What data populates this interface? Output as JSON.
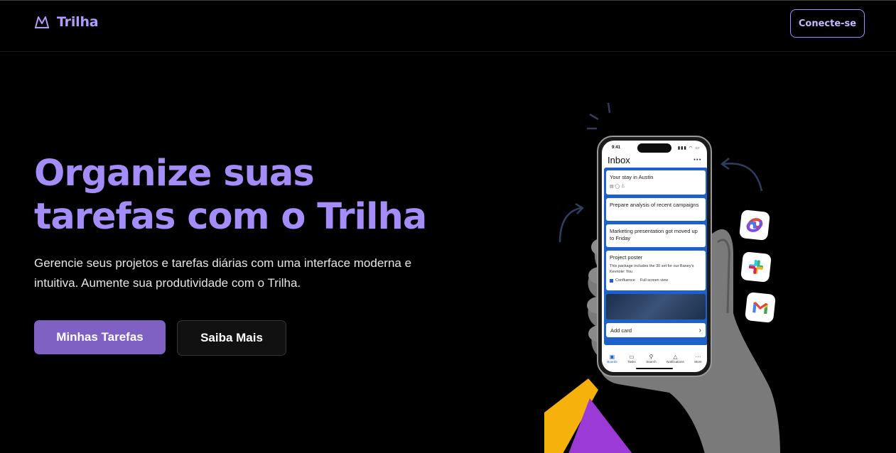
{
  "header": {
    "brand_name": "Trilha",
    "brand_icon": "mountain-logo-icon",
    "connect_label": "Conecte-se"
  },
  "hero": {
    "title_line1": "Organize suas",
    "title_line2": "tarefas com o Trilha",
    "subtitle_line1": "Gerencie seus projetos e tarefas diárias com uma interface moderna e",
    "subtitle_line2": "intuitiva. Aumente sua produtividade com o Trilha.",
    "primary_button": "Minhas Tarefas",
    "secondary_button": "Saiba Mais"
  },
  "phone": {
    "time": "9:41",
    "status_icons": "▮▮▮ ◠ ▭",
    "screen_title": "Inbox",
    "more": "···",
    "cards": [
      {
        "title": "Your stay in Austin",
        "meta": "▤ ◯ ⏃"
      },
      {
        "title": "Prepare analysis of recent campaigns"
      },
      {
        "title": "Marketing presentation got moved up to Friday"
      },
      {
        "title": "Project poster",
        "detail": "This package includes the 30 set for our Baney's Kevnole: You",
        "confluence": "Confluence",
        "full_screen": "Full screen view"
      }
    ],
    "add_card": "Add card",
    "add_card_chevron": "›",
    "tabs": [
      {
        "label": "Boards",
        "icon": "boards-icon",
        "glyph": "▣"
      },
      {
        "label": "Tasks",
        "icon": "tasks-icon",
        "glyph": "▭"
      },
      {
        "label": "Search",
        "icon": "search-icon",
        "glyph": "⚲"
      },
      {
        "label": "Notifications",
        "icon": "bell-icon",
        "glyph": "△"
      },
      {
        "label": "More",
        "icon": "more-icon",
        "glyph": "···"
      }
    ]
  },
  "integrations": [
    "copilot-icon",
    "slack-icon",
    "gmail-icon"
  ],
  "colors": {
    "accent": "#a48cf9",
    "primary_button": "#7e61c2",
    "board_blue": "#1d62c9",
    "yellow_shape": "#f6b20a",
    "purple_shape": "#9b3ad6"
  }
}
